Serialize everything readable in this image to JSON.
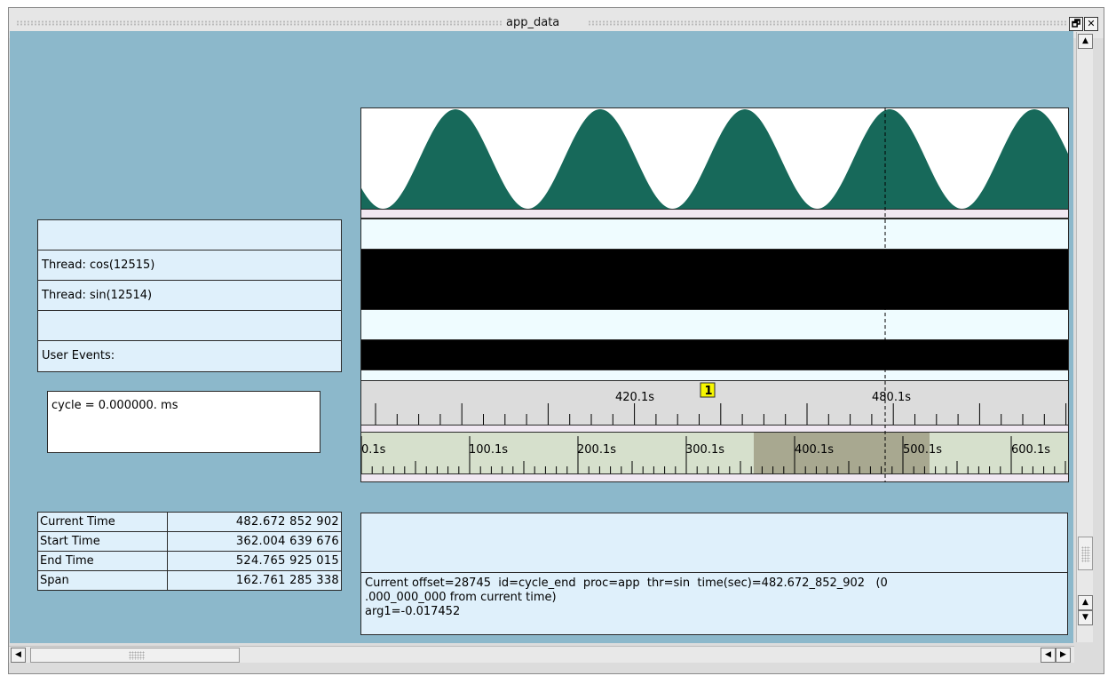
{
  "window": {
    "title": "app_data",
    "restore_label": "🗗",
    "close_label": "✕"
  },
  "threads": {
    "rows": [
      {
        "label": ""
      },
      {
        "label": "Thread: cos(12515)"
      },
      {
        "label": "Thread: sin(12514)"
      },
      {
        "label": ""
      },
      {
        "label": "User Events:"
      }
    ]
  },
  "cycle_readout": "cycle = 0.000000. ms",
  "zoom_axis": {
    "marker_label": "1",
    "tick_labels": [
      "420.1s",
      "480.1s"
    ]
  },
  "overview_axis": {
    "tick_labels": [
      "0.1s",
      "100.1s",
      "200.1s",
      "300.1s",
      "400.1s",
      "500.1s",
      "600.1s"
    ]
  },
  "times": {
    "rows": [
      {
        "label": "Current Time",
        "value": "482.672 852 902"
      },
      {
        "label": "Start Time",
        "value": "362.004 639 676"
      },
      {
        "label": "End Time",
        "value": "524.765 925 015"
      },
      {
        "label": "Span",
        "value": "162.761 285 338"
      }
    ]
  },
  "info": {
    "line1": "Current offset=28745  id=cycle_end  proc=app  thr=sin  time(sec)=482.672_852_902   (0",
    "line2": ".000_000_000 from current time)",
    "line3": "arg1=-0.017452"
  },
  "colors": {
    "background": "#8cb8cb",
    "wave": "#17695a",
    "panel": "#dff0fb",
    "marker": "#f7f700",
    "selection": "#a8a890"
  }
}
